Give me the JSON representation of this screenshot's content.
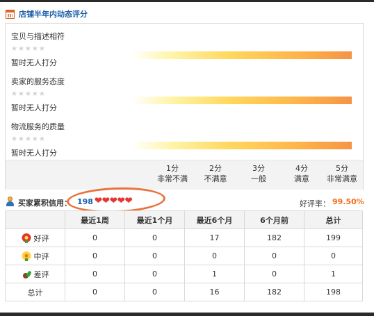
{
  "section": {
    "title": "店铺半年内动态评分",
    "icon": "calendar-icon"
  },
  "ratings": [
    {
      "label": "宝贝与描述相符",
      "stars": 5,
      "status": "暂时无人打分",
      "score": null
    },
    {
      "label": "卖家的服务态度",
      "stars": 5,
      "status": "暂时无人打分",
      "score": null
    },
    {
      "label": "物流服务的质量",
      "stars": 5,
      "status": "暂时无人打分",
      "score": null
    }
  ],
  "scale": [
    {
      "score": "1分",
      "desc": "非常不满"
    },
    {
      "score": "2分",
      "desc": "不满意"
    },
    {
      "score": "3分",
      "desc": "一般"
    },
    {
      "score": "4分",
      "desc": "满意"
    },
    {
      "score": "5分",
      "desc": "非常满意"
    }
  ],
  "buyer_credit": {
    "label": "买家累积信用：",
    "score": "198",
    "heart_count": 5,
    "icon": "person-icon",
    "heart_icon": "heart-icon"
  },
  "good_rate": {
    "label": "好评率：",
    "value": "99.50%"
  },
  "table": {
    "headers": [
      "",
      "最近1周",
      "最近1个月",
      "最近6个月",
      "6个月前",
      "总计"
    ],
    "rows": [
      {
        "label": "好评",
        "icon": "red-flower-icon",
        "values": [
          "0",
          "0",
          "17",
          "182",
          "199"
        ]
      },
      {
        "label": "中评",
        "icon": "yellow-flower-icon",
        "values": [
          "0",
          "0",
          "0",
          "0",
          "0"
        ]
      },
      {
        "label": "差评",
        "icon": "wilted-flower-icon",
        "values": [
          "0",
          "0",
          "1",
          "0",
          "1"
        ]
      },
      {
        "label": "总计",
        "icon": "",
        "values": [
          "0",
          "0",
          "16",
          "182",
          "198"
        ]
      }
    ]
  },
  "colors": {
    "link_blue": "#1a5ea8",
    "accent_orange": "#f56a1a",
    "oval_orange": "#e9723c",
    "heart_red": "#e8342f"
  }
}
